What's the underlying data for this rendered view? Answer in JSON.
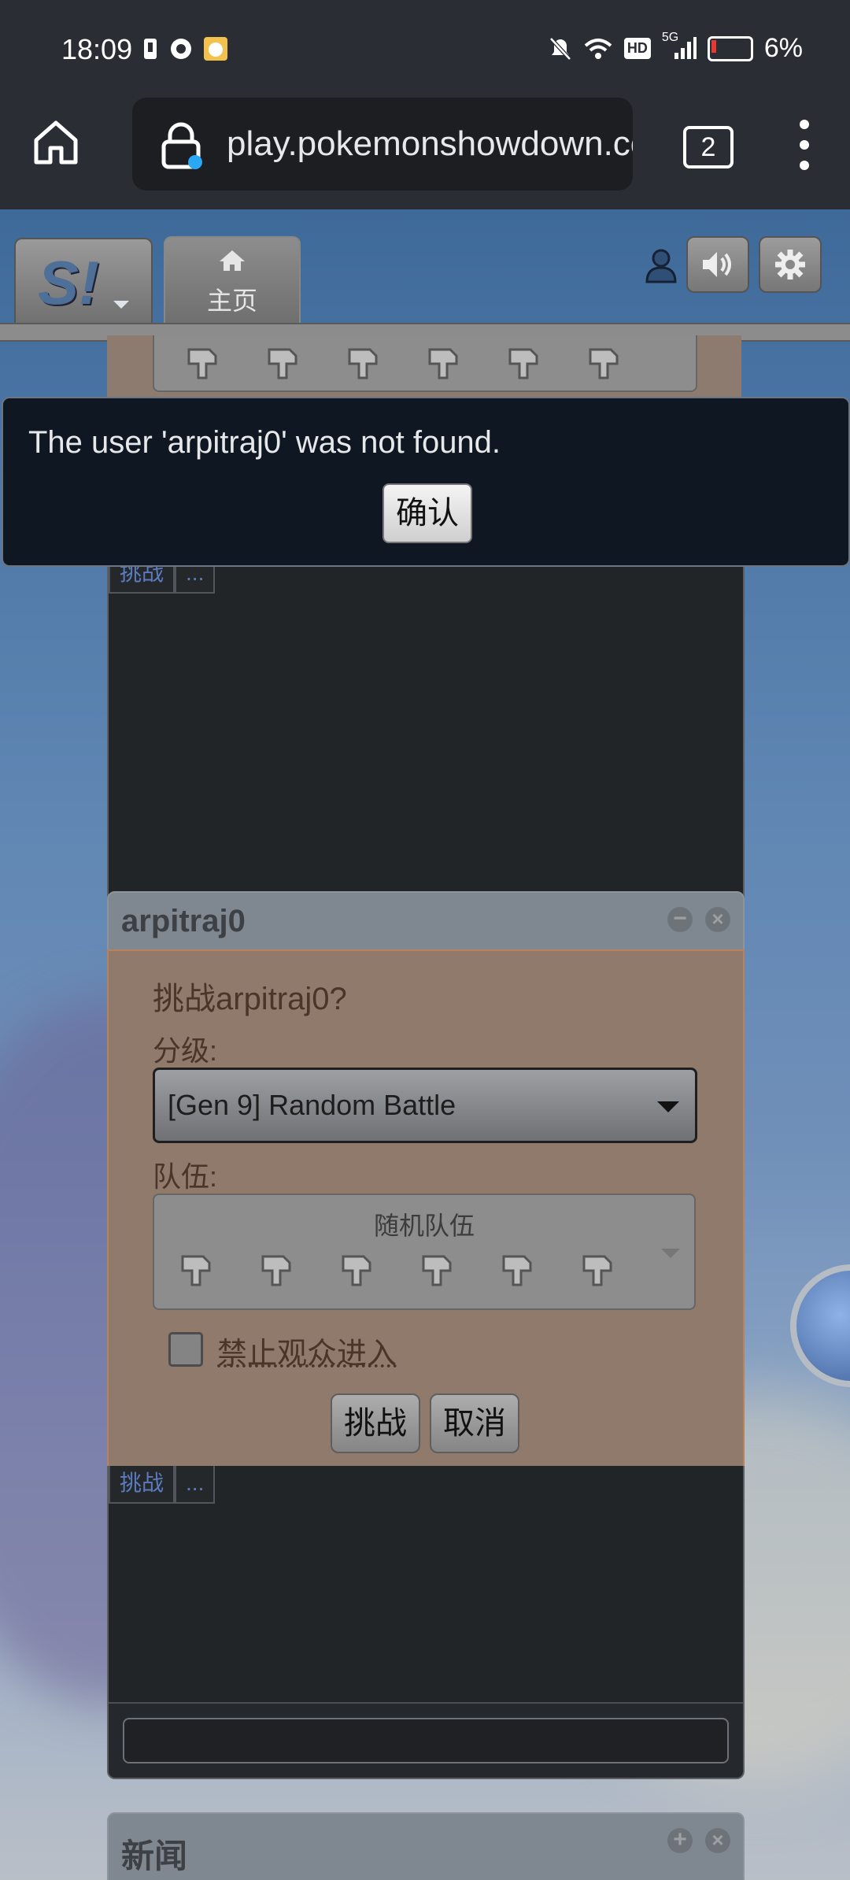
{
  "status_bar": {
    "time": "18:09",
    "network": "5G",
    "hd": "HD",
    "battery": "6%"
  },
  "browser": {
    "url": "play.pokemonshowdown.com",
    "tab_count": "2"
  },
  "header": {
    "logo": "S!",
    "home_tab_label": "主页"
  },
  "chat_tabs": {
    "challenge": "挑战",
    "more": "..."
  },
  "challenge_panel": {
    "title": "arpitraj0",
    "question": "挑战arpitraj0?",
    "format_label": "分级:",
    "format_value": "[Gen 9] Random Battle",
    "team_label": "队伍:",
    "team_value": "随机队伍",
    "no_spectators_label": "禁止观众进入",
    "challenge_button": "挑战",
    "cancel_button": "取消"
  },
  "news_panel": {
    "title": "新闻"
  },
  "dialog": {
    "message": "The user 'arpitraj0' was not found.",
    "ok_button": "确认"
  }
}
